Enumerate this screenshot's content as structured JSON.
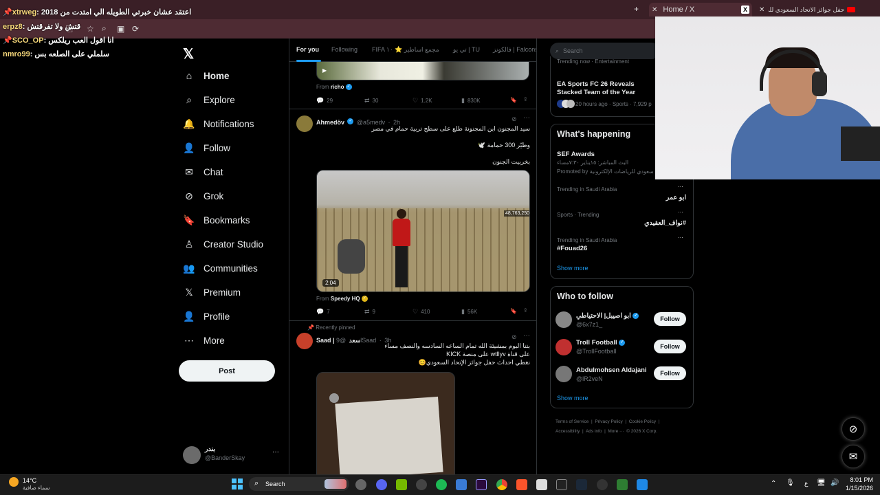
{
  "browser": {
    "tabs": [
      {
        "title": "Home / X"
      },
      {
        "title": "حفل جوائز الاتحاد السعودي للرياض"
      }
    ],
    "new_tab": "+",
    "close": "✕"
  },
  "chat_overlay": [
    {
      "user": "xtrweg",
      "text": "اعتقد عشان خبرتي الطويله الي امتدت من 2018"
    },
    {
      "user": "erpz8",
      "text": "قتش ولا تفرقتش"
    },
    {
      "user": "SCO_OP",
      "text": "انا اقول العب ريلكس"
    },
    {
      "user": "nmro99",
      "text": "سلملي على الصلعه بس"
    }
  ],
  "nav": {
    "items": [
      {
        "label": "Home",
        "icon": "home-icon",
        "glyph": "⌂"
      },
      {
        "label": "Explore",
        "icon": "search-icon",
        "glyph": "⌕"
      },
      {
        "label": "Notifications",
        "icon": "bell-icon",
        "glyph": "🔔"
      },
      {
        "label": "Follow",
        "icon": "person-add-icon",
        "glyph": "👤"
      },
      {
        "label": "Chat",
        "icon": "mail-icon",
        "glyph": "✉"
      },
      {
        "label": "Grok",
        "icon": "grok-icon",
        "glyph": "⊘"
      },
      {
        "label": "Bookmarks",
        "icon": "bookmark-icon",
        "glyph": "🔖"
      },
      {
        "label": "Creator Studio",
        "icon": "creator-icon",
        "glyph": "♙"
      },
      {
        "label": "Communities",
        "icon": "communities-icon",
        "glyph": "👥"
      },
      {
        "label": "Premium",
        "icon": "x-icon",
        "glyph": "𝕏"
      },
      {
        "label": "Profile",
        "icon": "profile-icon",
        "glyph": "👤"
      },
      {
        "label": "More",
        "icon": "more-circle-icon",
        "glyph": "⋯"
      }
    ],
    "post": "Post",
    "account": {
      "name": "بندر",
      "handle": "@BanderSkay",
      "more": "···"
    }
  },
  "feed_tabs": [
    "For you",
    "Following",
    "FIFA مجمع اساطير ⭐ ١٠",
    "تي يو | TU",
    "فالكونز | Falcons"
  ],
  "feed": {
    "post1": {
      "from_prefix": "From",
      "from_name": "richo",
      "replies": "29",
      "reposts": "30",
      "likes": "1.2K",
      "views": "830K"
    },
    "post2": {
      "name": "Ahmedöv",
      "handle": "@a5medv",
      "time": "2h",
      "line1": "سيد المجنون ابن المجنونة طلع على سطح تربية حمام في مصر",
      "line2": "وطيّر 300 حمامة 🕊️",
      "line3": "بخربيت الجنون",
      "duration": "2:04",
      "viewer_count": "48,763,250",
      "from_prefix": "From",
      "from_name": "Speedy HQ",
      "replies": "7",
      "reposts": "9",
      "likes": "410",
      "views": "56K"
    },
    "post3": {
      "pinned": "Recently pinned",
      "name": "Saad | سعد",
      "handle": "@9lSaad",
      "time": "3h",
      "line1": "بتنا اليوم بمشيئة الله تمام الساعه السادسه والنصف مساء",
      "line2": "على قناة wtllyv على منصة KICK",
      "line3": "نغطي احداث حفل جوائز الإتحاد السعودي😊"
    }
  },
  "right": {
    "search_placeholder": "Search",
    "top_trend": {
      "meta": "Trending now · Entertainment",
      "title": "EA Sports FC 26 Reveals Stacked Team of the Year",
      "posted": "20 hours ago · Sports · 7,929 p"
    },
    "whats_happening": {
      "title": "What's happening",
      "promo_title": "SEF Awards",
      "promo_sub": "البث المباشر: ١٥يناير ٧:٣٠مساء",
      "promo_by": "Promoted by الاتحاد السعودي للرياضات الإلكترونية",
      "trends": [
        {
          "meta": "Trending in Saudi Arabia",
          "name": "ابو عمر"
        },
        {
          "meta": "Sports · Trending",
          "name": "#نواف_العقيدي"
        },
        {
          "meta": "Trending in Saudi Arabia",
          "name": "#Fouad26"
        }
      ],
      "show_more": "Show more"
    },
    "who_to_follow": {
      "title": "Who to follow",
      "users": [
        {
          "name": "ابو اصيبل| الاحتياطي",
          "handle": "@6x7z1_",
          "button": "Follow"
        },
        {
          "name": "Troll Football",
          "handle": "@TrollFootball",
          "button": "Follow"
        },
        {
          "name": "Abdulmohsen Aldajani",
          "handle": "@lR2veN",
          "button": "Follow"
        }
      ],
      "show_more": "Show more"
    },
    "footer": [
      "Terms of Service",
      "Privacy Policy",
      "Cookie Policy",
      "Accessibility",
      "Ads info",
      "More ···",
      "© 2026 X Corp."
    ]
  },
  "taskbar": {
    "weather_temp": "14°C",
    "weather_desc": "سماء صافية",
    "search": "Search",
    "lang": "ع",
    "time": "8:01 PM",
    "date": "1/15/2026"
  },
  "colors": {
    "accent": "#1d9bf0",
    "tabbar": "#3a1f26",
    "background": "#000000"
  }
}
